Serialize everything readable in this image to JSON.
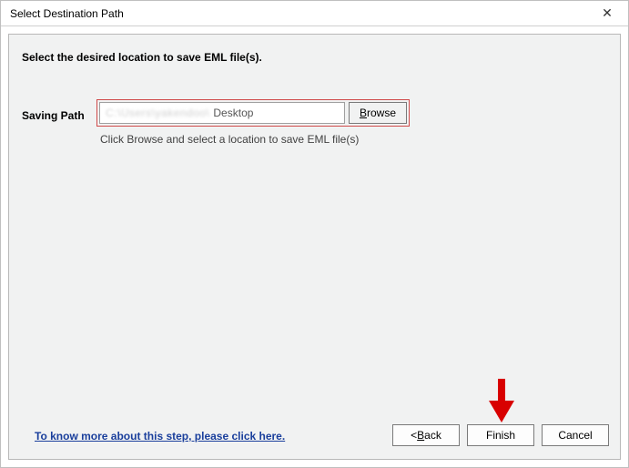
{
  "titlebar": {
    "title": "Select Destination Path",
    "close_glyph": "✕"
  },
  "heading": "Select the desired location to save EML file(s).",
  "saving_path_label": "Saving Path",
  "path": {
    "prefix_blur1": "C:\\",
    "prefix_blur2": "Users\\yakendoo\\",
    "value": "Desktop"
  },
  "browse": {
    "accel": "B",
    "rest": "rowse"
  },
  "hint": "Click Browse and select a location to save EML file(s)",
  "help_link": "To know more about this step, please click here.",
  "buttons": {
    "back": {
      "prefix": "< ",
      "accel": "B",
      "rest": "ack"
    },
    "finish": {
      "label": "Finish"
    },
    "cancel": {
      "label": "Cancel"
    }
  }
}
